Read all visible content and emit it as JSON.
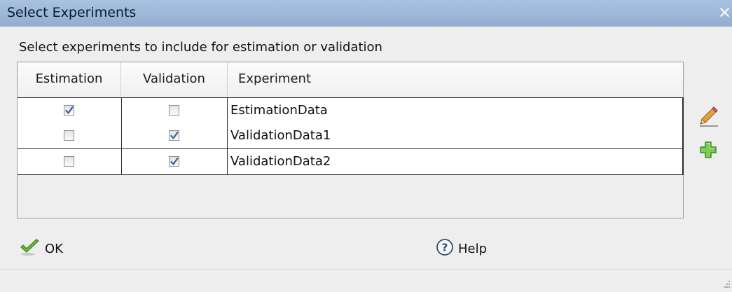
{
  "window": {
    "title": "Select Experiments",
    "close_glyph": "×"
  },
  "instruction": "Select experiments to include for estimation or validation",
  "table": {
    "columns": [
      "Estimation",
      "Validation",
      "Experiment"
    ],
    "rows": [
      {
        "estimation": true,
        "validation": false,
        "experiment": "EstimationData"
      },
      {
        "estimation": false,
        "validation": true,
        "experiment": "ValidationData1"
      },
      {
        "estimation": false,
        "validation": true,
        "experiment": "ValidationData2"
      }
    ]
  },
  "side_actions": {
    "edit_icon": "pencil-icon",
    "add_icon": "plus-icon"
  },
  "buttons": {
    "ok_label": "OK",
    "help_label": "Help"
  },
  "colors": {
    "titlebar": "#9cb7d8",
    "check_blue": "#3a5f9a",
    "ok_green": "#5aa52a",
    "add_green": "#6cc04a"
  }
}
